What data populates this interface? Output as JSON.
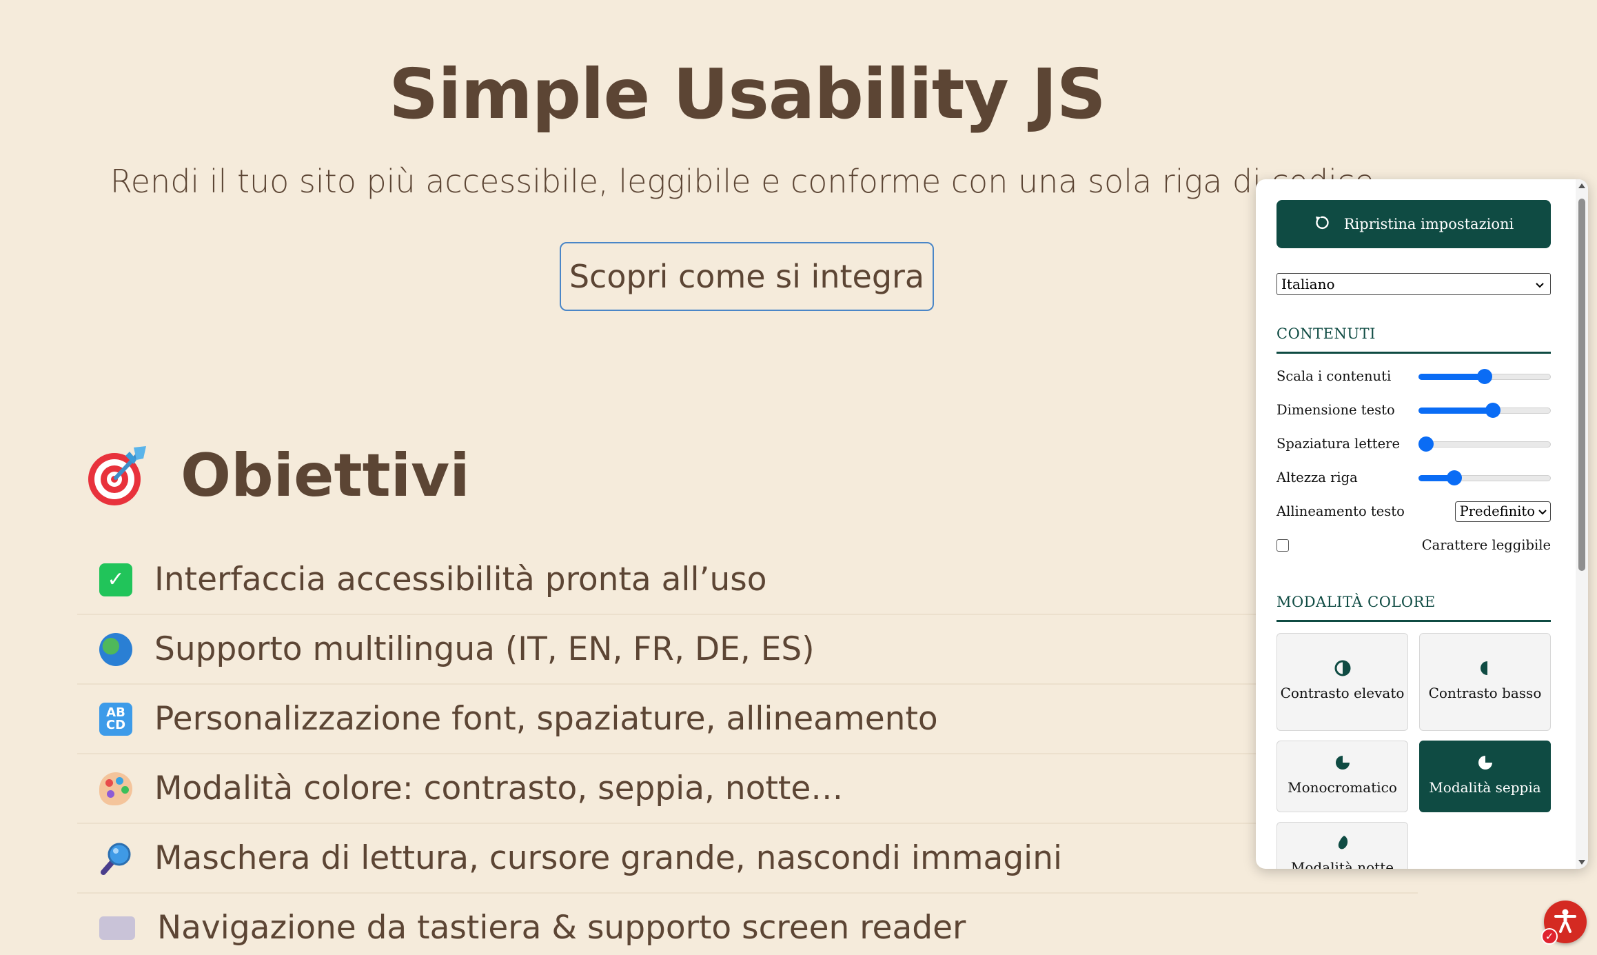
{
  "hero": {
    "title": "Simple Usability JS",
    "subtitle": "Rendi il tuo sito più accessibile, leggibile e conforme con una sola riga di codice.",
    "cta_label": "Scopri come si integra"
  },
  "objectives": {
    "heading": "Obiettivi",
    "heading_icon": "target-dart-icon",
    "items": [
      {
        "icon": "check-mark-icon",
        "label": "Interfaccia accessibilità pronta all’uso"
      },
      {
        "icon": "globe-icon",
        "label": "Supporto multilingua (IT, EN, FR, DE, ES)"
      },
      {
        "icon": "abcd-icon",
        "label": "Personalizzazione font, spaziature, allineamento"
      },
      {
        "icon": "palette-icon",
        "label": "Modalità colore: contrasto, seppia, notte…"
      },
      {
        "icon": "magnifier-icon",
        "label": "Maschera di lettura, cursore grande, nascondi immagini"
      },
      {
        "icon": "keyboard-icon",
        "label": "Navigazione da tastiera & supporto screen reader"
      }
    ]
  },
  "panel": {
    "reset_label": "Ripristina impostazioni",
    "language_value": "Italiano",
    "content_section": {
      "title": "CONTENUTI",
      "sliders": [
        {
          "label": "Scala i contenuti",
          "value": 0.5
        },
        {
          "label": "Dimensione testo",
          "value": 0.57
        },
        {
          "label": "Spaziatura lettere",
          "value": 0.0
        },
        {
          "label": "Altezza riga",
          "value": 0.24
        }
      ],
      "align_label": "Allineamento testo",
      "align_value": "Predefinito",
      "readable_font_label": "Carattere leggibile",
      "readable_font_checked": false
    },
    "color_section": {
      "title": "MODALITÀ COLORE",
      "modes": [
        {
          "label": "Contrasto elevato",
          "icon": "half-circle-icon",
          "active": false
        },
        {
          "label": "Contrasto basso",
          "icon": "half-moon-icon",
          "active": false
        },
        {
          "label": "Monocromatico",
          "icon": "quarter-pie-icon",
          "active": false
        },
        {
          "label": "Modalità seppia",
          "icon": "quarter-pie-icon",
          "active": true
        },
        {
          "label": "Modalità notte",
          "icon": "drop-icon",
          "active": false
        }
      ]
    }
  },
  "colors": {
    "background": "#f5ebdb",
    "text": "#5c4534",
    "panel_accent": "#0f4b43",
    "slider": "#0a6cf5",
    "a11y_button": "#d42a22"
  }
}
